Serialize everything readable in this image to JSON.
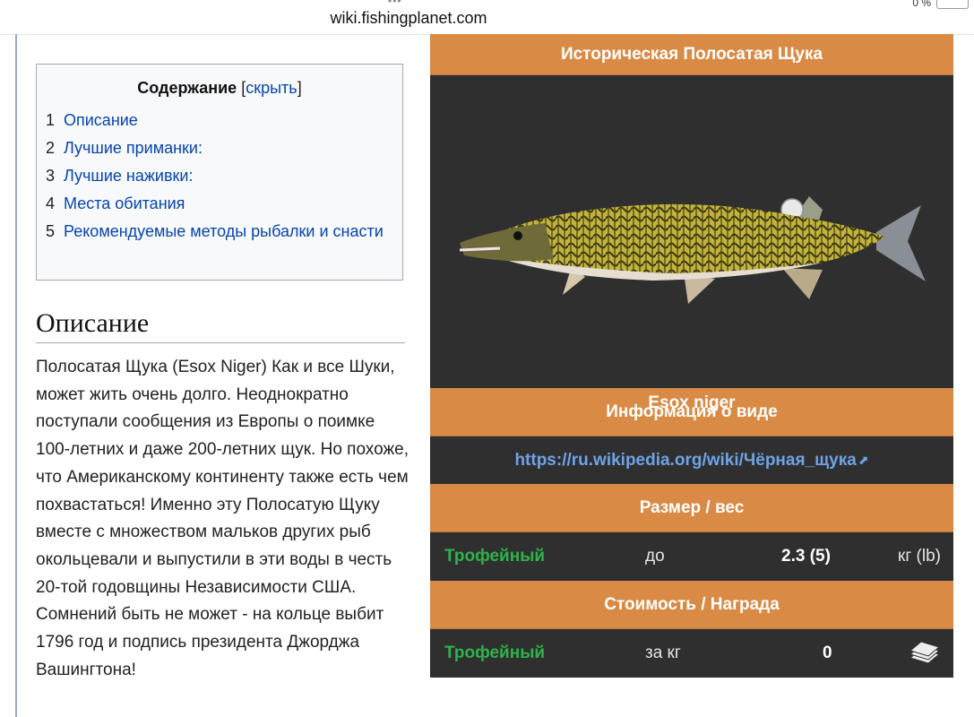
{
  "browser": {
    "url": "wiki.fishingplanet.com",
    "status_dots": "•••",
    "battery_text": "0 %"
  },
  "toc": {
    "title": "Содержание",
    "toggle_open": "[",
    "toggle_label": "скрыть",
    "toggle_close": "]",
    "items": [
      {
        "num": "1",
        "label": "Описание"
      },
      {
        "num": "2",
        "label": "Лучшие приманки:"
      },
      {
        "num": "3",
        "label": "Лучшие наживки:"
      },
      {
        "num": "4",
        "label": "Места обитания"
      },
      {
        "num": "5",
        "label": "Рекомендуемые методы рыбалки и снасти"
      }
    ]
  },
  "section": {
    "heading": "Описание",
    "text": "Полосатая Щука (Esox Niger) Как и все Шуки, может жить очень долго. Неоднократно поступали сообщения из Европы о поимке 100-летних и даже 200-летних щук. Но похоже, что Американскому континенту также есть чем похвастаться! Именно эту Полосатую Щуку вместе с множеством мальков других рыб окольцевали и выпустили в эти воды в честь 20-той годовщины Независимости США. Сомнений быть не может - на кольце выбит 1796 год и подпись президента Джорджа Вашингтона!"
  },
  "infobox": {
    "title": "Историческая Полосатая Щука",
    "species": "Esox niger",
    "info_header": "Информация о виде",
    "info_link": "https://ru.wikipedia.org/wiki/Чёрная_щука",
    "size_header": "Размер / вес",
    "size_row": {
      "label": "Трофейный",
      "prefix": "до",
      "value": "2.3 (5)",
      "unit": "кг (lb)"
    },
    "reward_header": "Стоимость / Награда",
    "reward_row": {
      "label": "Трофейный",
      "prefix": "за кг",
      "value": "0"
    },
    "icons": {
      "external_link": "external-link-icon",
      "money": "money-stack-icon"
    },
    "colors": {
      "header_orange": "#d98b45",
      "dark_bg": "#2f2f2f",
      "trophy_green": "#2db34a",
      "link_blue": "#6fa3e8"
    }
  }
}
